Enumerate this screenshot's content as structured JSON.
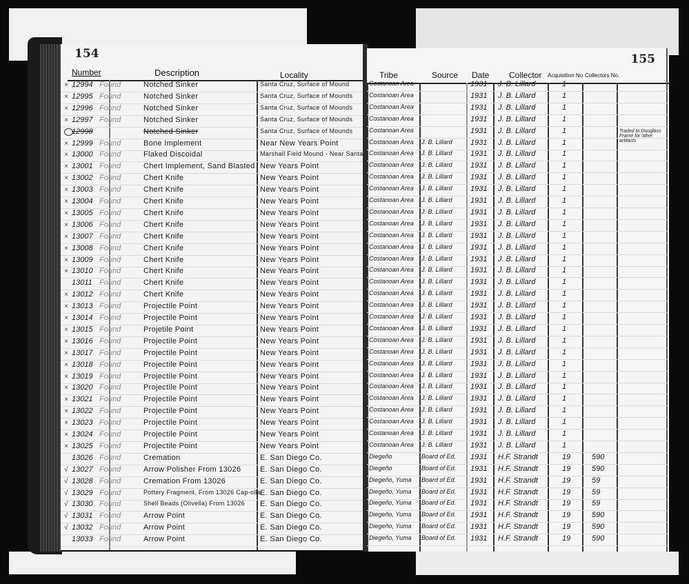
{
  "ledger": {
    "left_page_number": "154",
    "right_page_number": "155",
    "headers": {
      "number": "Number",
      "description": "Description",
      "locality": "Locality",
      "tribe": "Tribe",
      "source": "Source",
      "date": "Date",
      "collector": "Collector",
      "acquisition_no": "Acquisition No",
      "collectors_no": "Collectors No."
    },
    "remarks_note": "Traded to Douglass Frame for other artifacts",
    "rows": [
      {
        "mark": "x",
        "number": "12994",
        "pencil": "Found",
        "description": "Notched Sinker",
        "locality": "Santa Cruz, Surface of Mound",
        "tribe": "Costanoan Area",
        "source": "",
        "date": "1931",
        "collector": "J. B. Lillard",
        "acquisition_no": "1",
        "collectors_no": ""
      },
      {
        "mark": "x",
        "number": "12995",
        "pencil": "Found",
        "description": "Notched Sinker",
        "locality": "Santa Cruz, Surface of Mounds",
        "tribe": "Costanoan Area",
        "source": "",
        "date": "1931",
        "collector": "J. B. Lillard",
        "acquisition_no": "1",
        "collectors_no": ""
      },
      {
        "mark": "x",
        "number": "12996",
        "pencil": "Found",
        "description": "Notched Sinker",
        "locality": "Santa Cruz, Surface of Mounds",
        "tribe": "Costanoan Area",
        "source": "",
        "date": "1931",
        "collector": "J. B. Lillard",
        "acquisition_no": "1",
        "collectors_no": ""
      },
      {
        "mark": "x",
        "number": "12997",
        "pencil": "Found",
        "description": "Notched Sinker",
        "locality": "Santa Cruz, Surface of Mounds",
        "tribe": "Costanoan Area",
        "source": "",
        "date": "1931",
        "collector": "J. B. Lillard",
        "acquisition_no": "1",
        "collectors_no": ""
      },
      {
        "mark": "circle",
        "number": "12998",
        "pencil": "",
        "description": "Notched Sinker",
        "locality": "Santa Cruz, Surface of Mounds",
        "tribe": "Costanoan Area",
        "source": "",
        "date": "1931",
        "collector": "J. B. Lillard",
        "acquisition_no": "1",
        "collectors_no": "",
        "struck": true
      },
      {
        "mark": "x",
        "number": "12999",
        "pencil": "Found",
        "description": "Bone Implement",
        "locality": "Near New Years Point",
        "tribe": "Costanoan Area",
        "source": "J. B. Lillard",
        "date": "1931",
        "collector": "J. B. Lillard",
        "acquisition_no": "1",
        "collectors_no": ""
      },
      {
        "mark": "x",
        "number": "13000",
        "pencil": "Found",
        "description": "Flaked Discoidal",
        "locality": "Marshall Field Mound - Near Santa Cruz",
        "tribe": "Costanoan Area",
        "source": "J. B. Lillard",
        "date": "1931",
        "collector": "J. B. Lillard",
        "acquisition_no": "1",
        "collectors_no": ""
      },
      {
        "mark": "x",
        "number": "13001",
        "pencil": "Found",
        "description": "Chert Implement, Sand Blasted",
        "locality": "New Years Point",
        "tribe": "Costanoan Area",
        "source": "J. B. Lillard",
        "date": "1931",
        "collector": "J. B. Lillard",
        "acquisition_no": "1",
        "collectors_no": ""
      },
      {
        "mark": "x",
        "number": "13002",
        "pencil": "Found",
        "description": "Chert Knife",
        "locality": "New Years Point",
        "tribe": "Costanoan Area",
        "source": "J. B. Lillard",
        "date": "1931",
        "collector": "J. B. Lillard",
        "acquisition_no": "1",
        "collectors_no": ""
      },
      {
        "mark": "x",
        "number": "13003",
        "pencil": "Found",
        "description": "Chert Knife",
        "locality": "New Years Point",
        "tribe": "Costanoan Area",
        "source": "J. B. Lillard",
        "date": "1931",
        "collector": "J. B. Lillard",
        "acquisition_no": "1",
        "collectors_no": ""
      },
      {
        "mark": "x",
        "number": "13004",
        "pencil": "Found",
        "description": "Chert Knife",
        "locality": "New Years Point",
        "tribe": "Costanoan Area",
        "source": "J. B. Lillard",
        "date": "1931",
        "collector": "J. B. Lillard",
        "acquisition_no": "1",
        "collectors_no": ""
      },
      {
        "mark": "x",
        "number": "13005",
        "pencil": "Found",
        "description": "Chert Knife",
        "locality": "New Years Point",
        "tribe": "Costanoan Area",
        "source": "J. B. Lillard",
        "date": "1931",
        "collector": "J. B. Lillard",
        "acquisition_no": "1",
        "collectors_no": ""
      },
      {
        "mark": "x",
        "number": "13006",
        "pencil": "Found",
        "description": "Chert Knife",
        "locality": "New Years Point",
        "tribe": "Costanoan Area",
        "source": "J. B. Lillard",
        "date": "1931",
        "collector": "J. B. Lillard",
        "acquisition_no": "1",
        "collectors_no": ""
      },
      {
        "mark": "x",
        "number": "13007",
        "pencil": "Found",
        "description": "Chert Knife",
        "locality": "New Years Point",
        "tribe": "Costanoan Area",
        "source": "J. B. Lillard",
        "date": "1931",
        "collector": "J. B. Lillard",
        "acquisition_no": "1",
        "collectors_no": ""
      },
      {
        "mark": "x",
        "number": "13008",
        "pencil": "Found",
        "description": "Chert Knife",
        "locality": "New Years Point",
        "tribe": "Costanoan Area",
        "source": "J. B. Lillard",
        "date": "1931",
        "collector": "J. B. Lillard",
        "acquisition_no": "1",
        "collectors_no": ""
      },
      {
        "mark": "x",
        "number": "13009",
        "pencil": "Found",
        "description": "Chert Knife",
        "locality": "New Years Point",
        "tribe": "Costanoan Area",
        "source": "J. B. Lillard",
        "date": "1931",
        "collector": "J. B. Lillard",
        "acquisition_no": "1",
        "collectors_no": ""
      },
      {
        "mark": "x",
        "number": "13010",
        "pencil": "Found",
        "description": "Chert Knife",
        "locality": "New Years Point",
        "tribe": "Costanoan Area",
        "source": "J. B. Lillard",
        "date": "1931",
        "collector": "J. B. Lillard",
        "acquisition_no": "1",
        "collectors_no": ""
      },
      {
        "mark": "",
        "number": "13011",
        "pencil": "Found",
        "description": "Chert Knife",
        "locality": "New Years Point",
        "tribe": "Costanoan Area",
        "source": "J. B. Lillard",
        "date": "1931",
        "collector": "J. B. Lillard",
        "acquisition_no": "1",
        "collectors_no": ""
      },
      {
        "mark": "x",
        "number": "13012",
        "pencil": "Found",
        "description": "Chert Knife",
        "locality": "New Years Point",
        "tribe": "Costanoan Area",
        "source": "J. B. Lillard",
        "date": "1931",
        "collector": "J. B. Lillard",
        "acquisition_no": "1",
        "collectors_no": ""
      },
      {
        "mark": "x",
        "number": "13013",
        "pencil": "Found",
        "description": "Projectile Point",
        "locality": "New Years Point",
        "tribe": "Costanoan Area",
        "source": "J. B. Lillard",
        "date": "1931",
        "collector": "J. B. Lillard",
        "acquisition_no": "1",
        "collectors_no": ""
      },
      {
        "mark": "x",
        "number": "13014",
        "pencil": "Found",
        "description": "Projectile Point",
        "locality": "New Years Point",
        "tribe": "Costanoan Area",
        "source": "J. B. Lillard",
        "date": "1931",
        "collector": "J. B. Lillard",
        "acquisition_no": "1",
        "collectors_no": ""
      },
      {
        "mark": "x",
        "number": "13015",
        "pencil": "Found",
        "description": "Projetile Point",
        "locality": "New Years Point",
        "tribe": "Costanoan Area",
        "source": "J. B. Lillard",
        "date": "1931",
        "collector": "J. B. Lillard",
        "acquisition_no": "1",
        "collectors_no": ""
      },
      {
        "mark": "x",
        "number": "13016",
        "pencil": "Found",
        "description": "Projectile Point",
        "locality": "New Years Point",
        "tribe": "Costanoan Area",
        "source": "J. B. Lillard",
        "date": "1931",
        "collector": "J. B. Lillard",
        "acquisition_no": "1",
        "collectors_no": ""
      },
      {
        "mark": "x",
        "number": "13017",
        "pencil": "Found",
        "description": "Projectile Point",
        "locality": "New Years Point",
        "tribe": "Costanoan Area",
        "source": "J. B. Lillard",
        "date": "1931",
        "collector": "J. B. Lillard",
        "acquisition_no": "1",
        "collectors_no": ""
      },
      {
        "mark": "x",
        "number": "13018",
        "pencil": "Found",
        "description": "Projectile Point",
        "locality": "New Years Point",
        "tribe": "Costanoan Area",
        "source": "J. B. Lillard",
        "date": "1931",
        "collector": "J. B. Lillard",
        "acquisition_no": "1",
        "collectors_no": ""
      },
      {
        "mark": "x",
        "number": "13019",
        "pencil": "Found",
        "description": "Projectile Point",
        "locality": "New Years Point",
        "tribe": "Costanoan Area",
        "source": "J. B. Lillard",
        "date": "1931",
        "collector": "J. B. Lillard",
        "acquisition_no": "1",
        "collectors_no": ""
      },
      {
        "mark": "x",
        "number": "13020",
        "pencil": "Found",
        "description": "Projectile Point",
        "locality": "New Years Point",
        "tribe": "Costanoan Area",
        "source": "J. B. Lillard",
        "date": "1931",
        "collector": "J. B. Lillard",
        "acquisition_no": "1",
        "collectors_no": ""
      },
      {
        "mark": "x",
        "number": "13021",
        "pencil": "Found",
        "description": "Projectile Point",
        "locality": "New Years Point",
        "tribe": "Costanoan Area",
        "source": "J. B. Lillard",
        "date": "1931",
        "collector": "J. B. Lillard",
        "acquisition_no": "1",
        "collectors_no": ""
      },
      {
        "mark": "x",
        "number": "13022",
        "pencil": "Found",
        "description": "Projectile Point",
        "locality": "New Years Point",
        "tribe": "Costanoan Area",
        "source": "J. B. Lillard",
        "date": "1931",
        "collector": "J. B. Lillard",
        "acquisition_no": "1",
        "collectors_no": ""
      },
      {
        "mark": "x",
        "number": "13023",
        "pencil": "Found",
        "description": "Projectile Point",
        "locality": "New Years Point",
        "tribe": "Costanoan Area",
        "source": "J. B. Lillard",
        "date": "1931",
        "collector": "J. B. Lillard",
        "acquisition_no": "1",
        "collectors_no": ""
      },
      {
        "mark": "x",
        "number": "13024",
        "pencil": "Found",
        "description": "Projectile Point",
        "locality": "New Years Point",
        "tribe": "Costanoan Area",
        "source": "J. B. Lillard",
        "date": "1931",
        "collector": "J. B. Lillard",
        "acquisition_no": "1",
        "collectors_no": ""
      },
      {
        "mark": "x",
        "number": "13025",
        "pencil": "Found",
        "description": "Projectile Point",
        "locality": "New Years Point",
        "tribe": "Costanoan Area",
        "source": "J. B. Lillard",
        "date": "1931",
        "collector": "J. B. Lillard",
        "acquisition_no": "1",
        "collectors_no": ""
      },
      {
        "mark": "",
        "number": "13026",
        "pencil": "Found",
        "description": "Cremation",
        "locality": "E. San Diego Co.",
        "tribe": "Diegeño",
        "source": "Board of Ed.",
        "date": "1931",
        "collector": "H.F. Strandt",
        "acquisition_no": "19",
        "collectors_no": "590"
      },
      {
        "mark": "check",
        "number": "13027",
        "pencil": "Found",
        "description": "Arrow Polisher  From 13026",
        "locality": "E. San Diego Co.",
        "tribe": "Diegeño",
        "source": "Board of Ed.",
        "date": "1931",
        "collector": "H.F. Strandt",
        "acquisition_no": "19",
        "collectors_no": "590"
      },
      {
        "mark": "check",
        "number": "13028",
        "pencil": "Found",
        "description": "Cremation  From 13026",
        "locality": "E. San Diego Co.",
        "tribe": "Diegeño, Yuma",
        "source": "Board of Ed.",
        "date": "1931",
        "collector": "H.F. Strandt",
        "acquisition_no": "19",
        "collectors_no": "59"
      },
      {
        "mark": "check",
        "number": "13029",
        "pencil": "Found",
        "description": "Pottery Fragment, From 13026 Cap-olla",
        "locality": "E. San Diego Co.",
        "tribe": "Diegeño, Yuma",
        "source": "Board of Ed.",
        "date": "1931",
        "collector": "H.F. Strandt",
        "acquisition_no": "19",
        "collectors_no": "59"
      },
      {
        "mark": "check",
        "number": "13030",
        "pencil": "Found",
        "description": "Shell Beads (Olivella) From 13026",
        "locality": "E. San Diego Co.",
        "tribe": "Diegeño, Yuma",
        "source": "Board of Ed.",
        "date": "1931",
        "collector": "H.F. Strandt",
        "acquisition_no": "19",
        "collectors_no": "59"
      },
      {
        "mark": "check",
        "number": "13031",
        "pencil": "Found",
        "description": "Arrow Point",
        "locality": "E. San Diego Co.",
        "tribe": "Diegeño, Yuma",
        "source": "Board of Ed.",
        "date": "1931",
        "collector": "H.F. Strandt",
        "acquisition_no": "19",
        "collectors_no": "590"
      },
      {
        "mark": "check",
        "number": "13032",
        "pencil": "Found",
        "description": "Arrow Point",
        "locality": "E. San Diego Co.",
        "tribe": "Diegeño, Yuma",
        "source": "Board of Ed.",
        "date": "1931",
        "collector": "H.F. Strandt",
        "acquisition_no": "19",
        "collectors_no": "590"
      },
      {
        "mark": "",
        "number": "13033",
        "pencil": "Found",
        "description": "Arrow Point",
        "locality": "E. San Diego Co.",
        "tribe": "Diegeño, Yuma",
        "source": "Board of Ed.",
        "date": "1931",
        "collector": "H.F. Strandt",
        "acquisition_no": "19",
        "collectors_no": "590"
      }
    ]
  }
}
